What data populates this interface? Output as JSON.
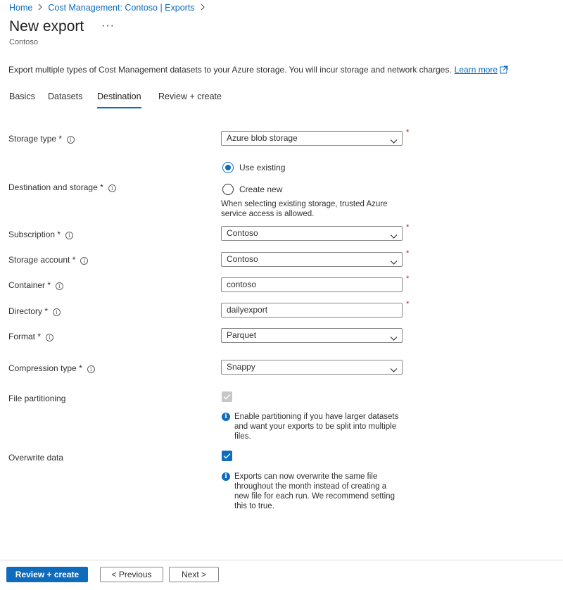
{
  "breadcrumb": {
    "home": "Home",
    "parent": "Cost Management: Contoso | Exports"
  },
  "header": {
    "title": "New export",
    "more": "···",
    "subtitle": "Contoso"
  },
  "description": {
    "text": "Export multiple types of Cost Management datasets to your Azure storage. You will incur storage and network charges.",
    "link": "Learn more"
  },
  "tabs": [
    "Basics",
    "Datasets",
    "Destination",
    "Review + create"
  ],
  "active_tab": "Destination",
  "form": {
    "storage_type": {
      "label": "Storage type",
      "value": "Azure blob storage"
    },
    "destination": {
      "label": "Destination and storage",
      "options": [
        "Use existing",
        "Create new"
      ],
      "selected": "Use existing",
      "note": "When selecting existing storage, trusted Azure service access is allowed."
    },
    "subscription": {
      "label": "Subscription",
      "value": "Contoso"
    },
    "storage_account": {
      "label": "Storage account",
      "value": "Contoso"
    },
    "container": {
      "label": "Container",
      "value": "contoso"
    },
    "directory": {
      "label": "Directory",
      "value": "dailyexport"
    },
    "format": {
      "label": "Format",
      "value": "Parquet"
    },
    "compression": {
      "label": "Compression type",
      "value": "Snappy"
    },
    "file_partitioning": {
      "label": "File partitioning",
      "checked": true,
      "disabled": true,
      "info": "Enable partitioning if you have larger datasets and want your exports to be split into multiple files."
    },
    "overwrite": {
      "label": "Overwrite data",
      "checked": true,
      "info": "Exports can now overwrite the same file throughout the month instead of creating a new file for each run. We recommend setting this to true."
    },
    "required_marker": "*",
    "info_glyph": "i"
  },
  "footer": {
    "review_create": "Review + create",
    "previous": "< Previous",
    "next": "Next >"
  },
  "colors": {
    "accent": "#0f6cbd",
    "required": "#a4262c"
  }
}
